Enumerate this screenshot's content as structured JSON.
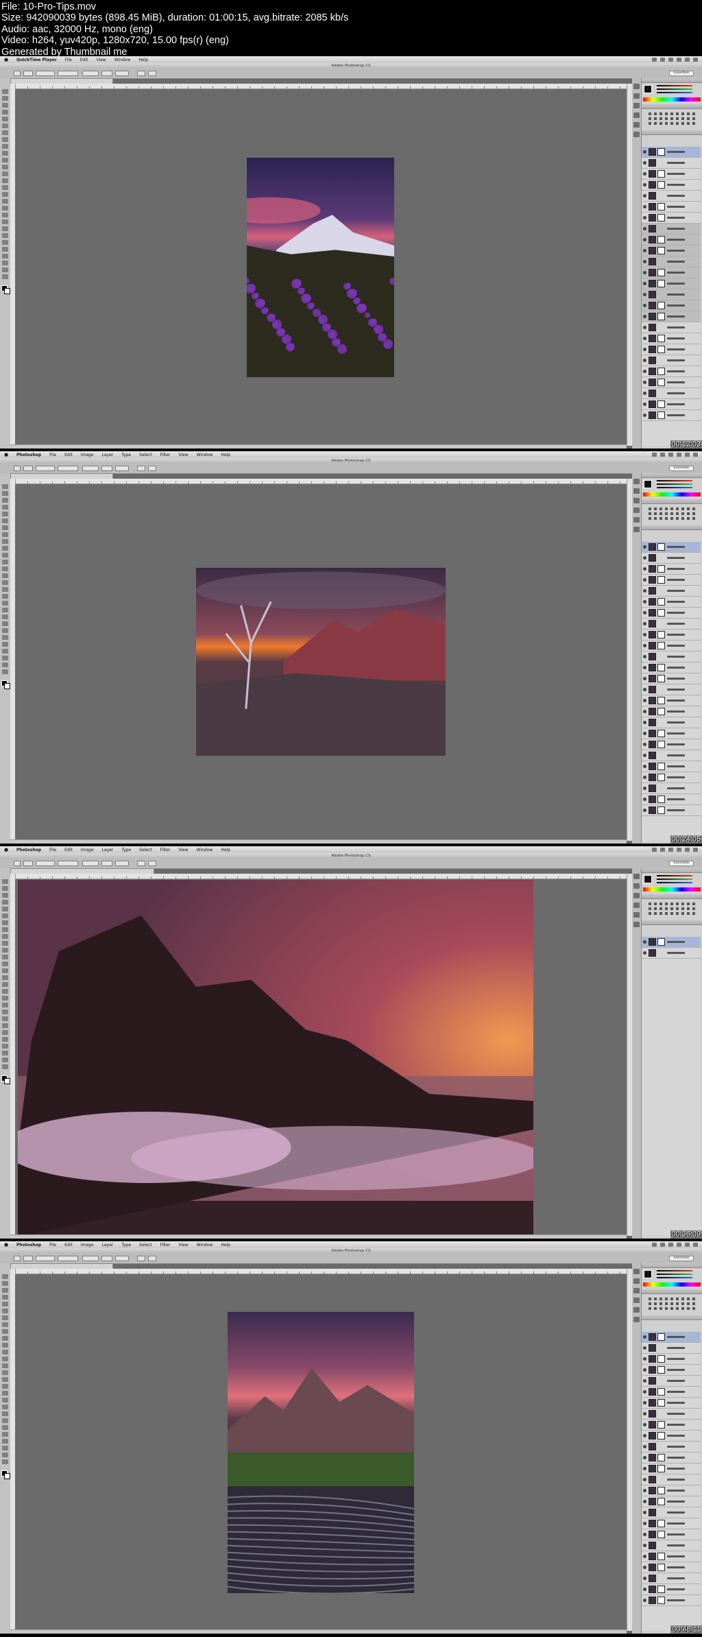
{
  "header": {
    "lines": [
      "File: 10-Pro-Tips.mov",
      "Size: 942090039 bytes (898.45 MiB), duration: 01:00:15, avg.bitrate: 2085 kb/s",
      "Audio: aac, 32000 Hz, mono (eng)",
      "Video: h264, yuv420p, 1280x720, 15.00 fps(r) (eng)",
      "Generated by Thumbnail me"
    ]
  },
  "window_title": "Adobe Photoshop CS",
  "essentials_label": "Essentials",
  "frames": [
    {
      "menu": [
        "QuickTime Player",
        "File",
        "Edit",
        "View",
        "Window",
        "Help"
      ],
      "timestamp": "00:12:03",
      "photo_colors": {
        "sky_top": "#2a2350",
        "sky_glow": "#d8607a",
        "mountain": "#d9d6e8",
        "meadow": "#2d2a1e",
        "flowers": "#7a35b8"
      }
    },
    {
      "menu": [
        "Photoshop",
        "File",
        "Edit",
        "Image",
        "Layer",
        "Type",
        "Select",
        "Filter",
        "View",
        "Window",
        "Help"
      ],
      "timestamp": "00:24:05",
      "photo_colors": {
        "sky_top": "#3a2a44",
        "sun": "#f07a2a",
        "peaks": "#8a3a44",
        "ground": "#4a3a44",
        "tree": "#c8c0d0"
      }
    },
    {
      "menu": [
        "Photoshop",
        "File",
        "Edit",
        "Image",
        "Layer",
        "Type",
        "Select",
        "Filter",
        "View",
        "Window",
        "Help"
      ],
      "timestamp": "00:36:09",
      "photo_colors": {
        "sky_top": "#5a3348",
        "glow": "#f09a50",
        "rocks": "#2a1a1e",
        "surf": "#d8b0d0",
        "sea": "#8a5a6a"
      }
    },
    {
      "menu": [
        "Photoshop",
        "File",
        "Edit",
        "Image",
        "Layer",
        "Type",
        "Select",
        "Filter",
        "View",
        "Window",
        "Help"
      ],
      "timestamp": "00:48:11",
      "photo_colors": {
        "sky_top": "#3a2a50",
        "glow": "#e0707a",
        "peaks": "#6a4a50",
        "grass": "#3a5a2a",
        "stream": "#b0b0c8"
      }
    }
  ]
}
